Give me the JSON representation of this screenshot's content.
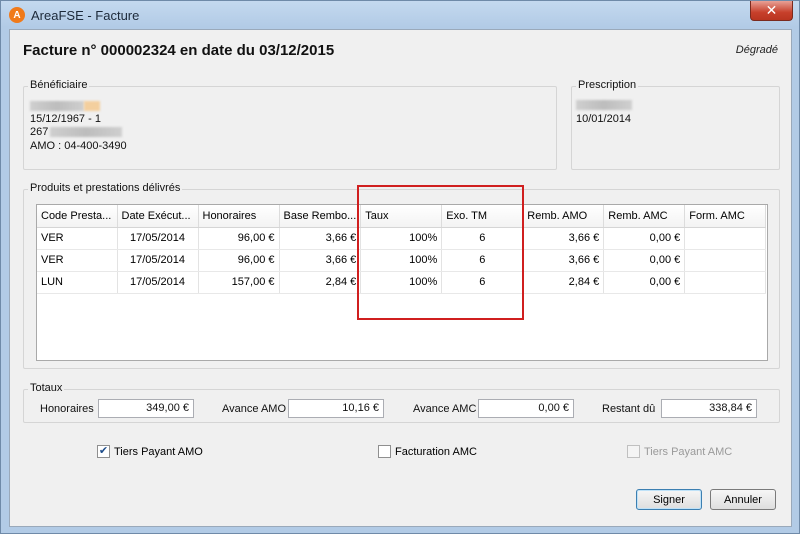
{
  "window": {
    "title": "AreaFSE - Facture",
    "close_glyph": "✕",
    "app_icon_letter": "A"
  },
  "header": {
    "title": "Facture n° 000002324 en date du 03/12/2015",
    "mode": "Dégradé"
  },
  "beneficiaire": {
    "legend": "Bénéficiaire",
    "birth": "15/12/1967 - 1",
    "nir_prefix": "267",
    "amo": "AMO : 04-400-3490"
  },
  "prescription": {
    "legend": "Prescription",
    "date": "10/01/2014"
  },
  "produits": {
    "legend": "Produits et prestations délivrés",
    "columns": [
      "Code Presta...",
      "Date Exécut...",
      "Honoraires",
      "Base Rembo...",
      "Taux",
      "Exo. TM",
      "Remb. AMO",
      "Remb. AMC",
      "Form. AMC"
    ],
    "rows": [
      [
        "VER",
        "17/05/2014",
        "96,00 €",
        "3,66 €",
        "100%",
        "6",
        "3,66 €",
        "0,00 €",
        ""
      ],
      [
        "VER",
        "17/05/2014",
        "96,00 €",
        "3,66 €",
        "100%",
        "6",
        "3,66 €",
        "0,00 €",
        ""
      ],
      [
        "LUN",
        "17/05/2014",
        "157,00 €",
        "2,84 €",
        "100%",
        "6",
        "2,84 €",
        "0,00 €",
        ""
      ]
    ]
  },
  "totaux": {
    "legend": "Totaux",
    "honoraires_label": "Honoraires",
    "honoraires": "349,00 €",
    "avance_amo_label": "Avance AMO",
    "avance_amo": "10,16 €",
    "avance_amc_label": "Avance AMC",
    "avance_amc": "0,00 €",
    "restant_label": "Restant dû",
    "restant": "338,84 €"
  },
  "options": {
    "tiers_payant_amo": {
      "label": "Tiers Payant AMO",
      "checked": true
    },
    "facturation_amc": {
      "label": "Facturation AMC",
      "checked": false
    },
    "tiers_payant_amc": {
      "label": "Tiers Payant AMC",
      "checked": false,
      "disabled": true
    }
  },
  "buttons": {
    "sign": "Signer",
    "cancel": "Annuler"
  },
  "colors": {
    "highlight": "#d01f1f",
    "app_icon": "#f07a1a",
    "close": "#c7402b"
  }
}
